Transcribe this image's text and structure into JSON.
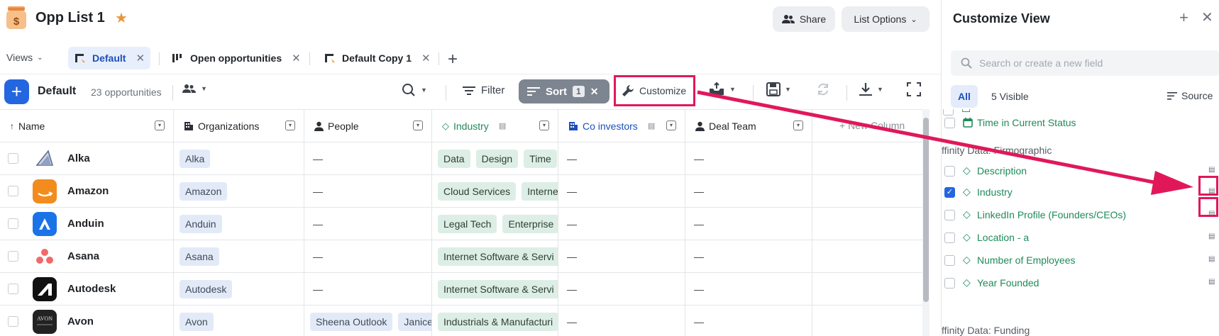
{
  "header": {
    "title": "Opp List 1",
    "share_label": "Share",
    "list_options_label": "List Options"
  },
  "views": {
    "label": "Views",
    "tabs": [
      {
        "label": "Default",
        "active": true
      },
      {
        "label": "Open opportunities",
        "active": false
      },
      {
        "label": "Default Copy 1",
        "active": false
      }
    ]
  },
  "toolbar": {
    "view_name": "Default",
    "count": "23 opportunities",
    "filter_label": "Filter",
    "sort_label": "Sort",
    "sort_count": "1",
    "customize_label": "Customize"
  },
  "table": {
    "columns": [
      {
        "label": "Name",
        "icon": "sort-up-icon"
      },
      {
        "label": "Organizations",
        "icon": "building-icon"
      },
      {
        "label": "People",
        "icon": "person-icon"
      },
      {
        "label": "Industry",
        "icon": "diamond-icon"
      },
      {
        "label": "Co investors",
        "icon": "building-icon"
      },
      {
        "label": "Deal Team",
        "icon": "person-icon"
      }
    ],
    "new_column_label": "+ New Column",
    "empty_value": "—",
    "rows": [
      {
        "name": "Alka",
        "org": "Alka",
        "people": [],
        "industry": [
          "Data",
          "Design",
          "Time"
        ]
      },
      {
        "name": "Amazon",
        "org": "Amazon",
        "people": [],
        "industry": [
          "Cloud Services",
          "Interne"
        ]
      },
      {
        "name": "Anduin",
        "org": "Anduin",
        "people": [],
        "industry": [
          "Legal Tech",
          "Enterprise"
        ]
      },
      {
        "name": "Asana",
        "org": "Asana",
        "people": [],
        "industry": [
          "Internet Software & Servi"
        ]
      },
      {
        "name": "Autodesk",
        "org": "Autodesk",
        "people": [],
        "industry": [
          "Internet Software & Servi"
        ]
      },
      {
        "name": "Avon",
        "org": "Avon",
        "people": [
          "Sheena Outlook",
          "Janice"
        ],
        "industry": [
          "Industrials & Manufacturi"
        ]
      }
    ]
  },
  "panel": {
    "title": "Customize View",
    "search_placeholder": "Search or create a new field",
    "filter_all": "All",
    "visible_count": "5 Visible",
    "source_label": "Source",
    "groups": [
      {
        "label": "ffinity Data: Firmographic"
      },
      {
        "label": "ffinity Data: Funding"
      }
    ],
    "fields": [
      {
        "name": "Time in Current Status",
        "checked": false,
        "icon": "calendar-icon"
      },
      {
        "name": "Description",
        "checked": false,
        "icon": "diamond-icon"
      },
      {
        "name": "Industry",
        "checked": true,
        "icon": "diamond-icon"
      },
      {
        "name": "LinkedIn Profile (Founders/CEOs)",
        "checked": false,
        "icon": "diamond-icon"
      },
      {
        "name": "Location - a",
        "checked": false,
        "icon": "diamond-icon"
      },
      {
        "name": "Number of Employees",
        "checked": false,
        "icon": "diamond-icon"
      },
      {
        "name": "Year Founded",
        "checked": false,
        "icon": "diamond-icon"
      }
    ]
  },
  "colors": {
    "accent": "#2466e0",
    "highlight": "#e0185a",
    "field_green": "#1f8a5b",
    "star": "#e8963c"
  }
}
